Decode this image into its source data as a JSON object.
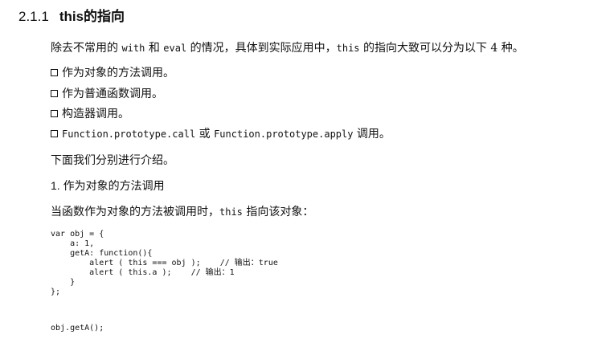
{
  "heading": {
    "number": "2.1.1",
    "title": "this的指向"
  },
  "intro": {
    "p1": "除去不常用的",
    "p2": "with",
    "p3": "和",
    "p4": "eval",
    "p5": "的情况，具体到实际应用中，",
    "p6": "this",
    "p7": "的指向大致可以分为以下 4 种。"
  },
  "bullets": [
    {
      "text": "作为对象的方法调用。"
    },
    {
      "text": "作为普通函数调用。"
    },
    {
      "text": "构造器调用。"
    },
    {
      "code1": "Function.prototype.call",
      "mid": "或",
      "code2": "Function.prototype.apply",
      "tail": "调用。"
    }
  ],
  "lead": "下面我们分别进行介绍。",
  "subheading": "1. 作为对象的方法调用",
  "explain": {
    "pre": "当函数作为对象的方法被调用时，",
    "code": "this",
    "post": "指向该对象："
  },
  "code_lines": [
    "var obj = {",
    "    a: 1,",
    "    getA: function(){",
    "        alert ( this === obj );    // 输出：true",
    "        alert ( this.a );    // 输出：1",
    "    }",
    "};"
  ],
  "code_tail": "obj.getA();"
}
